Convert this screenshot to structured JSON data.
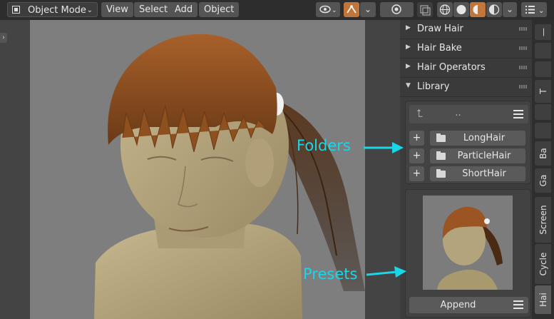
{
  "header": {
    "mode_label": "Object Mode",
    "menus": [
      "View",
      "Select",
      "Add",
      "Object"
    ],
    "icons": [
      "visibility-icon",
      "gizmo-icon",
      "overlay-icon",
      "xray-icon",
      "wireframe-shading-icon",
      "solid-shading-icon",
      "material-shading-icon",
      "rendered-shading-icon",
      "list-icon"
    ]
  },
  "sidebar": {
    "panels": [
      "Draw Hair",
      "Hair Bake",
      "Hair Operators",
      "Library"
    ],
    "library": {
      "path_label": "..",
      "folders": [
        "LongHair",
        "ParticleHair",
        "ShortHair"
      ],
      "append_label": "Append"
    }
  },
  "tabs": [
    "T",
    "Ba",
    "Ga",
    "Screen",
    "Cycle",
    "Hai"
  ],
  "annotations": {
    "folders": "Folders",
    "presets": "Presets"
  },
  "colors": {
    "accent": "#19d6e8",
    "hair": "#8a4a1c",
    "skin": "#b4a47e",
    "active_icon": "#c0763a"
  }
}
